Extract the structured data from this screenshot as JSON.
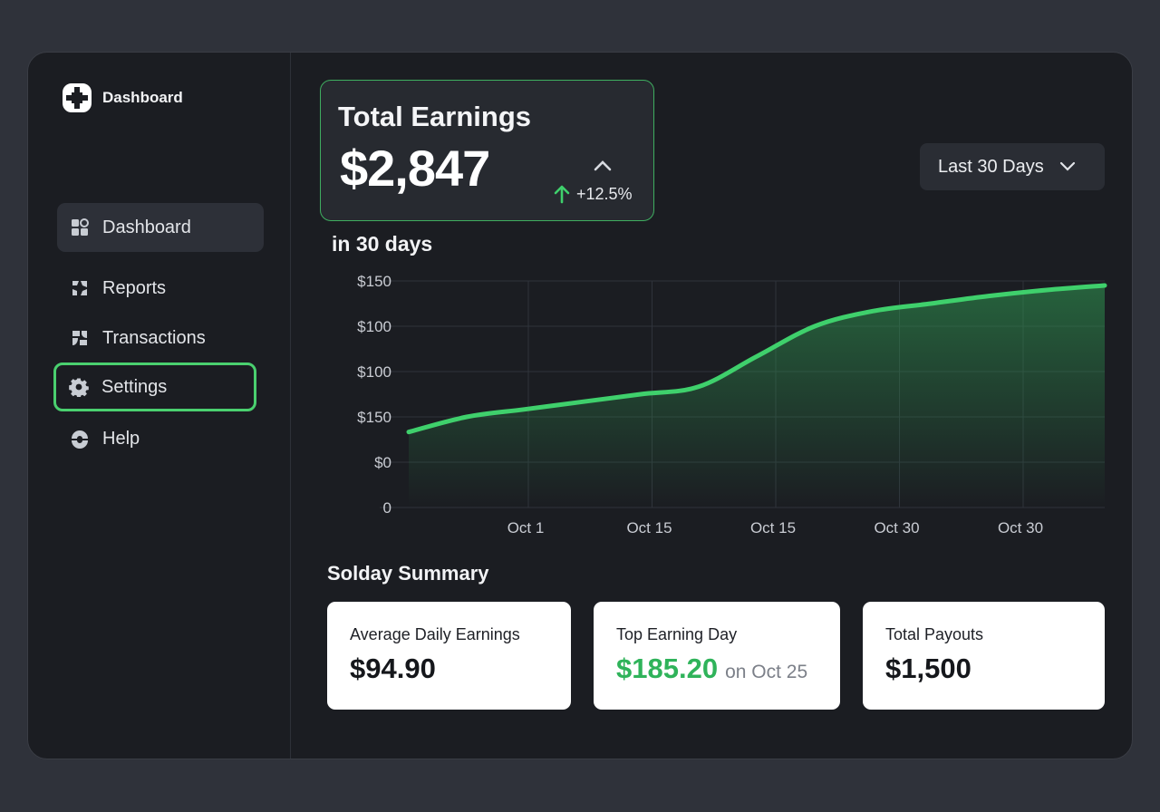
{
  "sidebar": {
    "brand": "Dashboard",
    "items": [
      {
        "label": "Dashboard",
        "icon": "grid-icon",
        "state": "active"
      },
      {
        "label": "Reports",
        "icon": "reports-icon",
        "state": "normal"
      },
      {
        "label": "Transactions",
        "icon": "transactions-icon",
        "state": "normal"
      },
      {
        "label": "Settings",
        "icon": "gear-icon",
        "state": "focused"
      },
      {
        "label": "Help",
        "icon": "help-icon",
        "state": "normal"
      }
    ]
  },
  "earnings": {
    "title": "Total Earnings",
    "value": "$2,847",
    "change": "+12.5%"
  },
  "range_select": {
    "value": "Last 30 Days"
  },
  "chart_section": {
    "subtitle": "in 30 days"
  },
  "chart_data": {
    "type": "area",
    "x_tick_labels": [
      "Oct 1",
      "Oct 15",
      "Oct 15",
      "Oct 30",
      "Oct 30"
    ],
    "y_tick_labels": [
      "$150",
      "$100",
      "$100",
      "$150",
      "$0",
      "0"
    ],
    "series": [
      {
        "x": [
          0,
          1,
          2,
          3,
          4,
          5,
          6,
          7,
          8,
          9,
          10,
          11,
          12
        ],
        "y": [
          50,
          60,
          65,
          70,
          75,
          80,
          100,
          120,
          130,
          135,
          140,
          144,
          147
        ]
      }
    ],
    "ylim": [
      0,
      150
    ],
    "grid": true
  },
  "summary": {
    "title": "Solday Summary",
    "cards": [
      {
        "label": "Average Daily Earnings",
        "value": "$94.90",
        "note": ""
      },
      {
        "label": "Top Earning Day",
        "value": "$185.20",
        "note": "on Oct 25"
      },
      {
        "label": "Total Payouts",
        "value": "$1,500",
        "note": ""
      }
    ]
  },
  "colors": {
    "accent": "#4ad06f",
    "background": "#1b1d22",
    "page": "#2f323a"
  }
}
